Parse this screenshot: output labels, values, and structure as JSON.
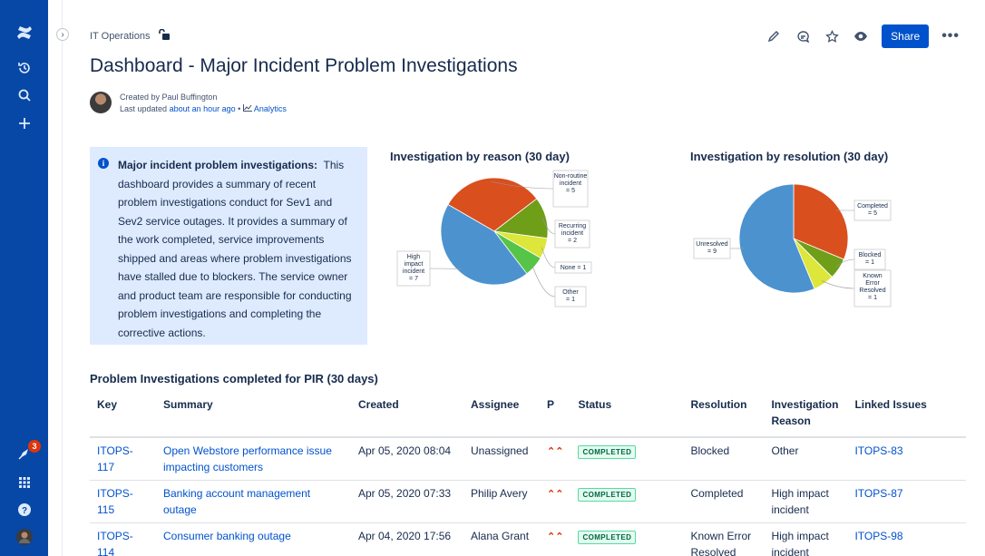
{
  "header": {
    "breadcrumb": "IT Operations",
    "title": "Dashboard - Major Incident Problem Investigations",
    "share_label": "Share",
    "more_label": "•••"
  },
  "byline": {
    "created_by": "Created by Paul Buffington",
    "last_updated_prefix": "Last updated",
    "last_updated_link": "about an hour ago",
    "separator": "•",
    "analytics": "Analytics"
  },
  "nav": {
    "notification_count": "3"
  },
  "info": {
    "heading": "Major incident problem investigations:",
    "body": "This dashboard provides a summary of recent problem investigations conduct for Sev1 and Sev2 service outages.  It provides a summary of the work completed, service improvements shipped and areas where problem investigations have stalled due to blockers.  The service owner and product team are responsible for conducting problem investigations and completing the corrective actions."
  },
  "chart_data": [
    {
      "type": "pie",
      "title": "Investigation by reason (30 day)",
      "slices": [
        {
          "label": "Non-routine incident = 5",
          "value": 5,
          "color": "#d94f1e"
        },
        {
          "label": "Recurring incident = 2",
          "value": 2,
          "color": "#6f9e18"
        },
        {
          "label": "None = 1",
          "value": 1,
          "color": "#dde63a"
        },
        {
          "label": "Other = 1",
          "value": 1,
          "color": "#56c446"
        },
        {
          "label": "High impact incident = 7",
          "value": 7,
          "color": "#4c92cf"
        }
      ]
    },
    {
      "type": "pie",
      "title": "Investigation by resolution (30 day)",
      "slices": [
        {
          "label": "Completed = 5",
          "value": 5,
          "color": "#d94f1e"
        },
        {
          "label": "Blocked = 1",
          "value": 1,
          "color": "#6f9e18"
        },
        {
          "label": "Known Error Resolved = 1",
          "value": 1,
          "color": "#dde63a"
        },
        {
          "label": "Unresolved = 9",
          "value": 9,
          "color": "#4c92cf"
        }
      ]
    }
  ],
  "table": {
    "title": "Problem Investigations completed for PIR (30 days)",
    "columns": [
      "Key",
      "Summary",
      "Created",
      "Assignee",
      "P",
      "Status",
      "Resolution",
      "Investigation Reason",
      "Linked Issues"
    ],
    "rows": [
      {
        "key": "ITOPS-117",
        "summary": "Open Webstore performance issue impacting customers",
        "created": "Apr 05, 2020 08:04",
        "assignee": "Unassigned",
        "priority": "⌃⌃",
        "status": "COMPLETED",
        "resolution": "Blocked",
        "reason": "Other",
        "linked": "ITOPS-83"
      },
      {
        "key": "ITOPS-115",
        "summary": "Banking account management outage",
        "created": "Apr 05, 2020 07:33",
        "assignee": "Philip Avery",
        "priority": "⌃⌃",
        "status": "COMPLETED",
        "resolution": "Completed",
        "reason": "High impact incident",
        "linked": "ITOPS-87"
      },
      {
        "key": "ITOPS-114",
        "summary": "Consumer banking outage",
        "created": "Apr 04, 2020 17:56",
        "assignee": "Alana Grant",
        "priority": "⌃⌃",
        "status": "COMPLETED",
        "resolution": "Known Error Resolved",
        "reason": "High impact incident",
        "linked": "ITOPS-98"
      }
    ]
  }
}
